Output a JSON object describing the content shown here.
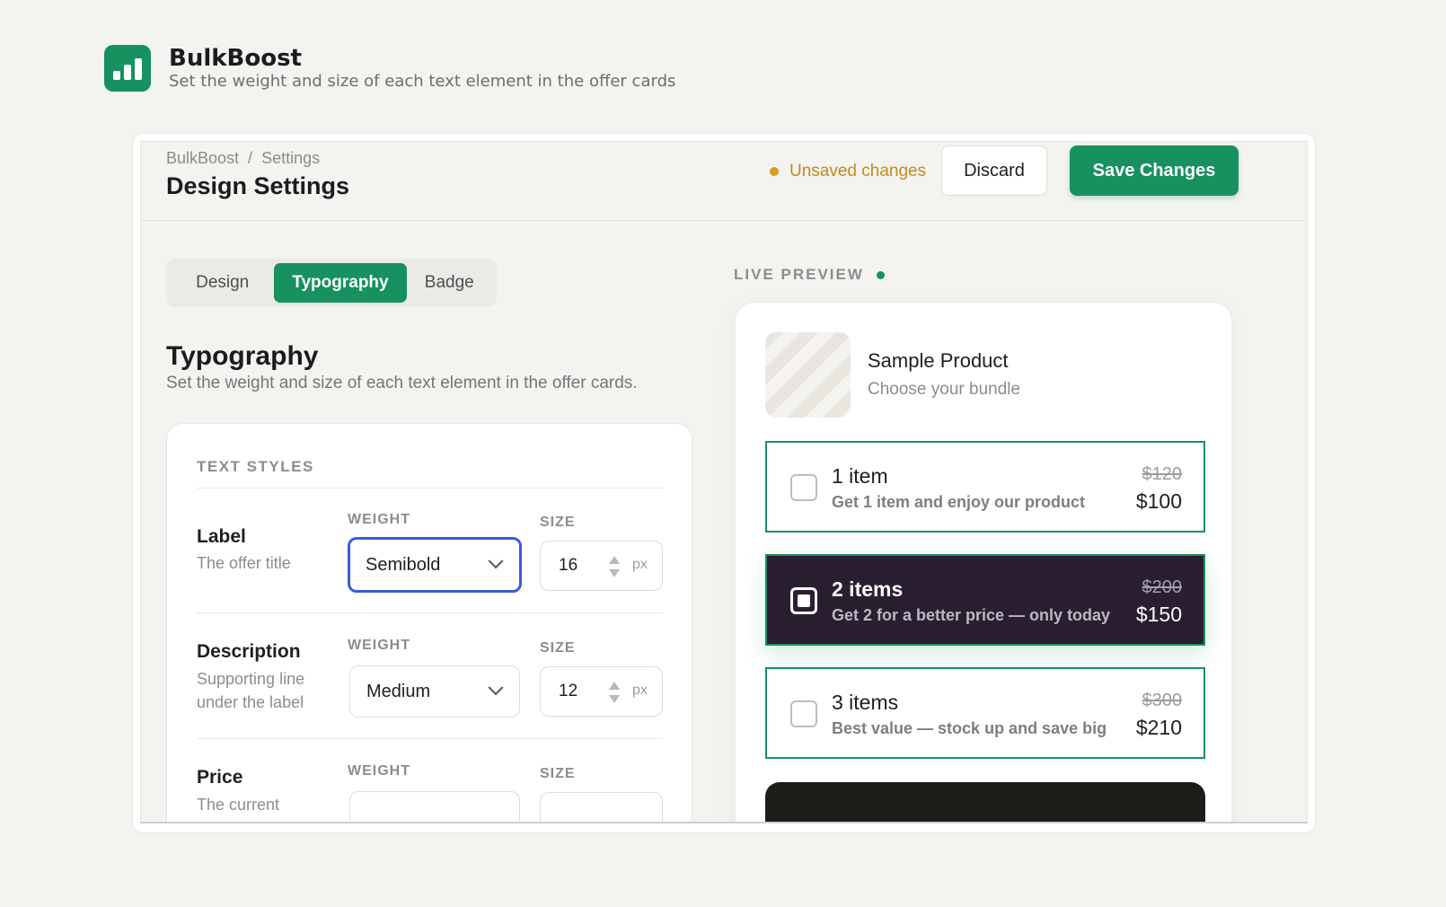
{
  "brand": {
    "name": "BulkBoost",
    "subtitle": "Set the weight and size of each text element in the offer cards"
  },
  "header": {
    "breadcrumb": [
      "BulkBoost",
      "/",
      "Settings"
    ],
    "title": "Design Settings",
    "unsaved_text": "Unsaved changes",
    "discard_label": "Discard",
    "save_label": "Save Changes"
  },
  "tabs": [
    {
      "label": "Design",
      "active": false
    },
    {
      "label": "Typography",
      "active": true
    },
    {
      "label": "Badge",
      "active": false
    }
  ],
  "section": {
    "title": "Typography",
    "subtitle": "Set the weight and size of each text element in the offer cards."
  },
  "text_styles": {
    "heading": "TEXT STYLES",
    "weight_label": "WEIGHT",
    "size_label": "SIZE",
    "unit": "px",
    "rows": [
      {
        "label": "Label",
        "hint": "The offer title",
        "weight": "Semibold",
        "size": "16"
      },
      {
        "label": "Description",
        "hint": "Supporting line under the label",
        "weight": "Medium",
        "size": "12"
      },
      {
        "label": "Price",
        "hint": "The current",
        "weight": "",
        "size": ""
      }
    ]
  },
  "preview": {
    "label": "LIVE PREVIEW",
    "product_name": "Sample Product",
    "product_sub": "Choose your bundle",
    "offers": [
      {
        "title": "1 item",
        "desc": "Get 1 item and enjoy our product",
        "old_price": "$120",
        "price": "$100",
        "selected": false
      },
      {
        "title": "2 items",
        "desc": "Get 2 for a better price — only today",
        "old_price": "$200",
        "price": "$150",
        "selected": true
      },
      {
        "title": "3 items",
        "desc": "Best value — stock up and save big",
        "old_price": "$300",
        "price": "$210",
        "selected": false
      }
    ]
  },
  "colors": {
    "accent": "#16915f",
    "warning": "#c48a1b",
    "focus": "#3b5bdb",
    "selected_offer_bg": "#2a1f30"
  },
  "icons": {
    "brand_logo": "bar-chart-icon",
    "select_chevron": "chevron-down-icon",
    "stepper": "stepper-arrows-icon"
  }
}
